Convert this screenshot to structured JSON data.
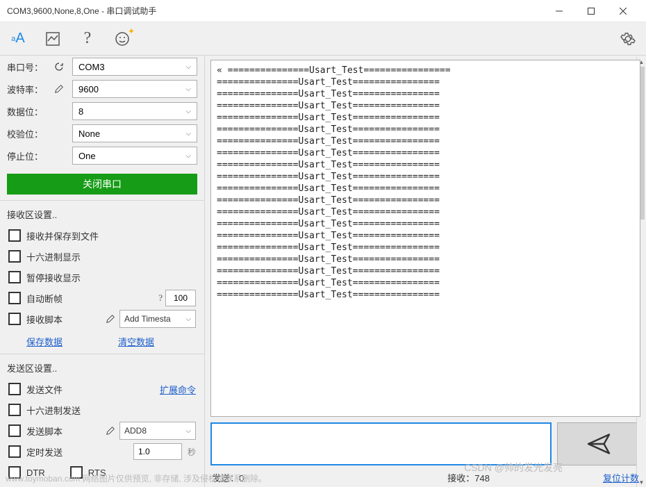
{
  "title": "COM3,9600,None,8,One - 串口调试助手",
  "toolbar": {
    "tool_font": "aA"
  },
  "config": {
    "port_label": "串口号：",
    "port_value": "COM3",
    "baud_label": "波特率：",
    "baud_value": "9600",
    "databits_label": "数据位：",
    "databits_value": "8",
    "parity_label": "校验位：",
    "parity_value": "None",
    "stopbits_label": "停止位：",
    "stopbits_value": "One",
    "close_btn": "关闭串口"
  },
  "rx_section": {
    "header": "接收区设置..",
    "opt_savefile": "接收并保存到文件",
    "opt_hex": "十六进制显示",
    "opt_pause": "暂停接收显示",
    "opt_autobreak": "自动断帧",
    "autobreak_hint": "?",
    "autobreak_value": "100",
    "opt_script": "接收脚本",
    "script_value": "Add Timesta",
    "save_data": "保存数据",
    "clear_data": "清空数据"
  },
  "tx_section": {
    "header": "发送区设置..",
    "opt_sendfile": "发送文件",
    "ext_cmd": "扩展命令",
    "opt_hexsend": "十六进制发送",
    "opt_sendscript": "发送脚本",
    "sendscript_value": "ADD8",
    "opt_timedsend": "定时发送",
    "timedsend_value": "1.0",
    "timedsend_unit": "秒",
    "opt_dtr": "DTR",
    "opt_rts": "RTS"
  },
  "terminal_lines": [
    "« ===============Usart_Test================",
    "===============Usart_Test================",
    "===============Usart_Test================",
    "===============Usart_Test================",
    "===============Usart_Test================",
    "===============Usart_Test================",
    "===============Usart_Test================",
    "===============Usart_Test================",
    "===============Usart_Test================",
    "===============Usart_Test================",
    "===============Usart_Test================",
    "===============Usart_Test================",
    "===============Usart_Test================",
    "===============Usart_Test================",
    "===============Usart_Test================",
    "===============Usart_Test================",
    "===============Usart_Test================",
    "===============Usart_Test================",
    "===============Usart_Test================",
    "===============Usart_Test================"
  ],
  "status": {
    "sent_label": "发送：",
    "sent_value": "0",
    "recv_label": "接收：",
    "recv_value": "748",
    "reset_link": "复位计数"
  },
  "watermarks": {
    "wm1": "www.toymoban.com  网络图片仅供预览, 非存储, 涉及侵权请联系删除。",
    "wm2": "CSDN @帅的发光发亮"
  }
}
